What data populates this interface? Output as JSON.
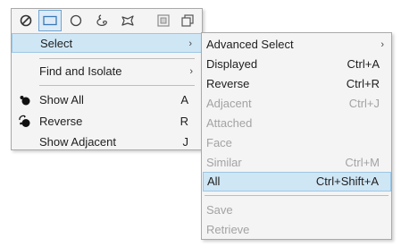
{
  "toolbar": {
    "tools": [
      {
        "icon": "no-selection-icon"
      },
      {
        "icon": "box-select-icon",
        "active": true
      },
      {
        "icon": "circle-select-icon"
      },
      {
        "icon": "freehand-select-icon"
      },
      {
        "icon": "polygon-select-icon"
      },
      {
        "icon": "select-inside-icon"
      },
      {
        "icon": "select-overlap-icon"
      }
    ]
  },
  "main_menu": {
    "select": {
      "label": "Select",
      "arrow": "›"
    },
    "find_and_isolate": {
      "label": "Find and Isolate",
      "arrow": "›"
    },
    "show_all": {
      "label": "Show All",
      "shortcut": "A",
      "icon": "show-all-icon"
    },
    "reverse": {
      "label": "Reverse",
      "shortcut": "R",
      "icon": "reverse-display-icon"
    },
    "show_adjacent": {
      "label": "Show Adjacent",
      "shortcut": "J"
    }
  },
  "sub_menu": {
    "advanced_select": {
      "label": "Advanced Select",
      "arrow": "›"
    },
    "displayed": {
      "label": "Displayed",
      "shortcut": "Ctrl+A"
    },
    "reverse": {
      "label": "Reverse",
      "shortcut": "Ctrl+R"
    },
    "adjacent": {
      "label": "Adjacent",
      "shortcut": "Ctrl+J",
      "disabled": true
    },
    "attached": {
      "label": "Attached",
      "disabled": true
    },
    "face": {
      "label": "Face",
      "disabled": true
    },
    "similar": {
      "label": "Similar",
      "shortcut": "Ctrl+M",
      "disabled": true
    },
    "all": {
      "label": "All",
      "shortcut": "Ctrl+Shift+A"
    },
    "save": {
      "label": "Save",
      "disabled": true
    },
    "retrieve": {
      "label": "Retrieve",
      "disabled": true
    }
  },
  "colors": {
    "highlight_bg": "#cfe6f5",
    "highlight_border": "#9cc7e4",
    "menu_bg": "#f4f4f4",
    "disabled_text": "#a3a3a3"
  }
}
